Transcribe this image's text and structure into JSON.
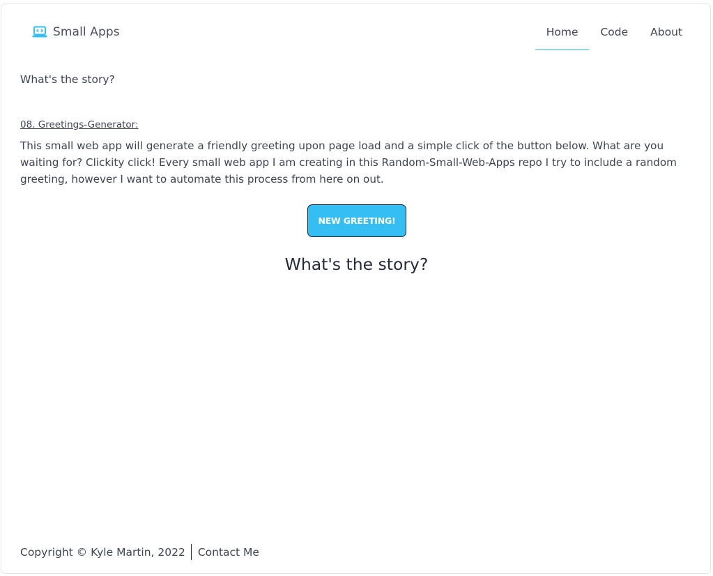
{
  "header": {
    "brand_name": "Small Apps",
    "brand_icon": "laptop-code-icon",
    "nav": [
      {
        "label": "Home",
        "active": true
      },
      {
        "label": "Code",
        "active": false
      },
      {
        "label": "About",
        "active": false
      }
    ]
  },
  "main": {
    "lead": "What's the story?",
    "app_link": "08. Greetings-Generator:",
    "description": "This small web app will generate a friendly greeting upon page load and a simple click of the button below. What are you waiting for? Clickity click! Every small web app I am creating in this Random-Small-Web-Apps repo I try to include a random greeting, however I want to automate this process from here on out.",
    "button_label": "NEW GREETING!",
    "greeting": "What's the story?"
  },
  "footer": {
    "copyright": "Copyright © Kyle Martin, 2022",
    "contact": "Contact Me"
  },
  "colors": {
    "accent": "#35bef1",
    "nav_underline": "#2ab2e8",
    "text": "#3d4454"
  }
}
